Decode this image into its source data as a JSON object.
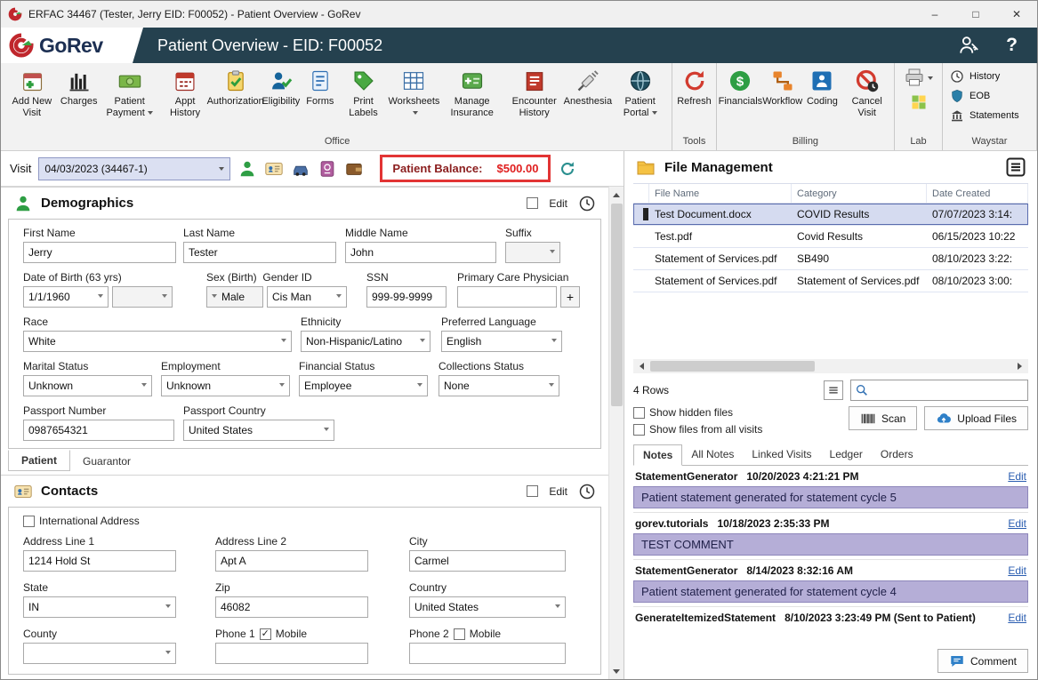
{
  "titlebar": {
    "title": "ERFAC 34467 (Tester, Jerry EID: F00052) - Patient Overview - GoRev",
    "minimize": "–",
    "maximize": "□",
    "close": "✕"
  },
  "header": {
    "app_name": "GoRev",
    "title": "Patient Overview - EID: F00052",
    "help_label": "?",
    "access_icon": "person-key",
    "logo_icon": "gorev-logo",
    "app_icon": "app-logo"
  },
  "toolbar": {
    "office": {
      "label": "Office",
      "items": [
        {
          "label": "Add New Visit",
          "icon": "calendar-plus"
        },
        {
          "label": "Charges",
          "icon": "charges"
        },
        {
          "label": "Patient Payment",
          "icon": "payment"
        },
        {
          "label": "Appt History",
          "icon": "calendar-red"
        },
        {
          "label": "Authorization",
          "icon": "clipboard-check"
        },
        {
          "label": "Eligibility",
          "icon": "person-check"
        },
        {
          "label": "Forms",
          "icon": "form-doc"
        },
        {
          "label": "Print Labels",
          "icon": "tag"
        },
        {
          "label": "Worksheets",
          "icon": "grid"
        },
        {
          "label": "Manage Insurance",
          "icon": "insurance-card"
        },
        {
          "label": "Encounter History",
          "icon": "encounter"
        },
        {
          "label": "Anesthesia",
          "icon": "syringe"
        },
        {
          "label": "Patient Portal",
          "icon": "globe"
        }
      ]
    },
    "tools": {
      "label": "Tools",
      "items": [
        {
          "label": "Refresh",
          "icon": "refresh-red"
        }
      ]
    },
    "billing": {
      "label": "Billing",
      "items": [
        {
          "label": "Financials",
          "icon": "dollar"
        },
        {
          "label": "Workflow",
          "icon": "workflow"
        },
        {
          "label": "Coding",
          "icon": "coding"
        },
        {
          "label": "Cancel Visit",
          "icon": "cancel"
        }
      ]
    },
    "lab": {
      "label": "Lab",
      "printer_icon": "printer",
      "panel_icon": "lab-panel"
    },
    "waystar": {
      "label": "Waystar",
      "items": [
        {
          "label": "History",
          "icon": "clock-small"
        },
        {
          "label": "EOB",
          "icon": "shield"
        },
        {
          "label": "Statements",
          "icon": "bank"
        }
      ]
    }
  },
  "visit": {
    "label": "Visit",
    "selected_visit": "04/03/2023 (34467-1)",
    "icons": [
      "person-green",
      "id-card",
      "car",
      "passport",
      "wallet"
    ],
    "balance_label": "Patient Balance:",
    "balance_value": "$500.00",
    "refresh_icon": "refresh-teal"
  },
  "demographics": {
    "title": "Demographics",
    "header_icon": "person-green",
    "edit_label": "Edit",
    "audit_icon": "clock-audit",
    "fields": {
      "first_name": {
        "label": "First Name",
        "value": "Jerry"
      },
      "last_name": {
        "label": "Last Name",
        "value": "Tester"
      },
      "middle_name": {
        "label": "Middle Name",
        "value": "John"
      },
      "suffix": {
        "label": "Suffix",
        "value": ""
      },
      "dob": {
        "label": "Date of Birth (63 yrs)",
        "value": "1/1/1960"
      },
      "sex": {
        "label": "Sex (Birth)",
        "value": "Male"
      },
      "gender": {
        "label": "Gender ID",
        "value": "Cis Man"
      },
      "ssn": {
        "label": "SSN",
        "value": "999-99-9999"
      },
      "pcp": {
        "label": "Primary Care Physician",
        "value": "",
        "add_label": "+"
      },
      "race": {
        "label": "Race",
        "value": "White"
      },
      "ethnicity": {
        "label": "Ethnicity",
        "value": "Non-Hispanic/Latino"
      },
      "preferred_language": {
        "label": "Preferred Language",
        "value": "English"
      },
      "marital_status": {
        "label": "Marital Status",
        "value": "Unknown"
      },
      "employment": {
        "label": "Employment",
        "value": "Unknown"
      },
      "financial_status": {
        "label": "Financial Status",
        "value": "Employee"
      },
      "collections_status": {
        "label": "Collections Status",
        "value": "None"
      },
      "passport_number": {
        "label": "Passport Number",
        "value": "0987654321"
      },
      "passport_country": {
        "label": "Passport Country",
        "value": "United States"
      }
    },
    "tabs": [
      "Patient",
      "Guarantor"
    ]
  },
  "contacts": {
    "title": "Contacts",
    "header_icon": "id-card",
    "edit_label": "Edit",
    "audit_icon": "clock-audit",
    "international_label": "International Address",
    "fields": {
      "address1": {
        "label": "Address Line 1",
        "value": "1214 Hold St"
      },
      "address2": {
        "label": "Address Line 2",
        "value": "Apt A"
      },
      "city": {
        "label": "City",
        "value": "Carmel"
      },
      "state": {
        "label": "State",
        "value": "IN"
      },
      "zip": {
        "label": "Zip",
        "value": "46082"
      },
      "country": {
        "label": "Country",
        "value": "United States"
      },
      "county": {
        "label": "County"
      },
      "phone1": {
        "label": "Phone 1",
        "mobile_label": "Mobile"
      },
      "phone2": {
        "label": "Phone 2",
        "mobile_label": "Mobile"
      }
    }
  },
  "file_management": {
    "title": "File Management",
    "folder_icon": "folder",
    "menu_icon": "menu-box",
    "columns": [
      "File Name",
      "Category",
      "Date Created"
    ],
    "rows": [
      {
        "file": "Test Document.docx",
        "category": "COVID Results",
        "date": "07/07/2023 3:14:"
      },
      {
        "file": "Test.pdf",
        "category": "Covid Results",
        "date": "06/15/2023 10:22"
      },
      {
        "file": "Statement of Services.pdf",
        "category": "SB490",
        "date": "08/10/2023 3:22:"
      },
      {
        "file": "Statement of Services.pdf",
        "category": "Statement of Services.pdf",
        "date": "08/10/2023 3:00:"
      }
    ],
    "row_count": "4 Rows",
    "list_icon": "menu-small",
    "search_icon": "magnifier",
    "search_value": "",
    "show_hidden_label": "Show hidden files",
    "show_all_visits_label": "Show files from all visits",
    "scan_label": "Scan",
    "scan_icon": "barcode",
    "upload_label": "Upload Files",
    "upload_icon": "cloud-upload"
  },
  "notes": {
    "tabs": [
      "Notes",
      "All Notes",
      "Linked Visits",
      "Ledger",
      "Orders"
    ],
    "active_tab": "Notes",
    "entries": [
      {
        "author": "StatementGenerator",
        "time": "10/20/2023 4:21:21 PM",
        "edit": "Edit",
        "message": "Patient statement generated for statement cycle 5"
      },
      {
        "author": "gorev.tutorials",
        "time": "10/18/2023 2:35:33 PM",
        "edit": "Edit",
        "message": "TEST COMMENT"
      },
      {
        "author": "StatementGenerator",
        "time": "8/14/2023 8:32:16 AM",
        "edit": "Edit",
        "message": "Patient statement generated for statement cycle 4"
      },
      {
        "author": "GenerateItemizedStatement",
        "time": "8/10/2023 3:23:49 PM (Sent to Patient)",
        "edit": "Edit",
        "message": ""
      }
    ],
    "comment_label": "Comment",
    "comment_icon": "chat"
  },
  "colors": {
    "header_bg": "#25414f",
    "balance_border": "#e23434",
    "balance_value": "#e02020",
    "note_highlight": "#b5aed7",
    "selected_row_bg": "#d5dbf0"
  }
}
